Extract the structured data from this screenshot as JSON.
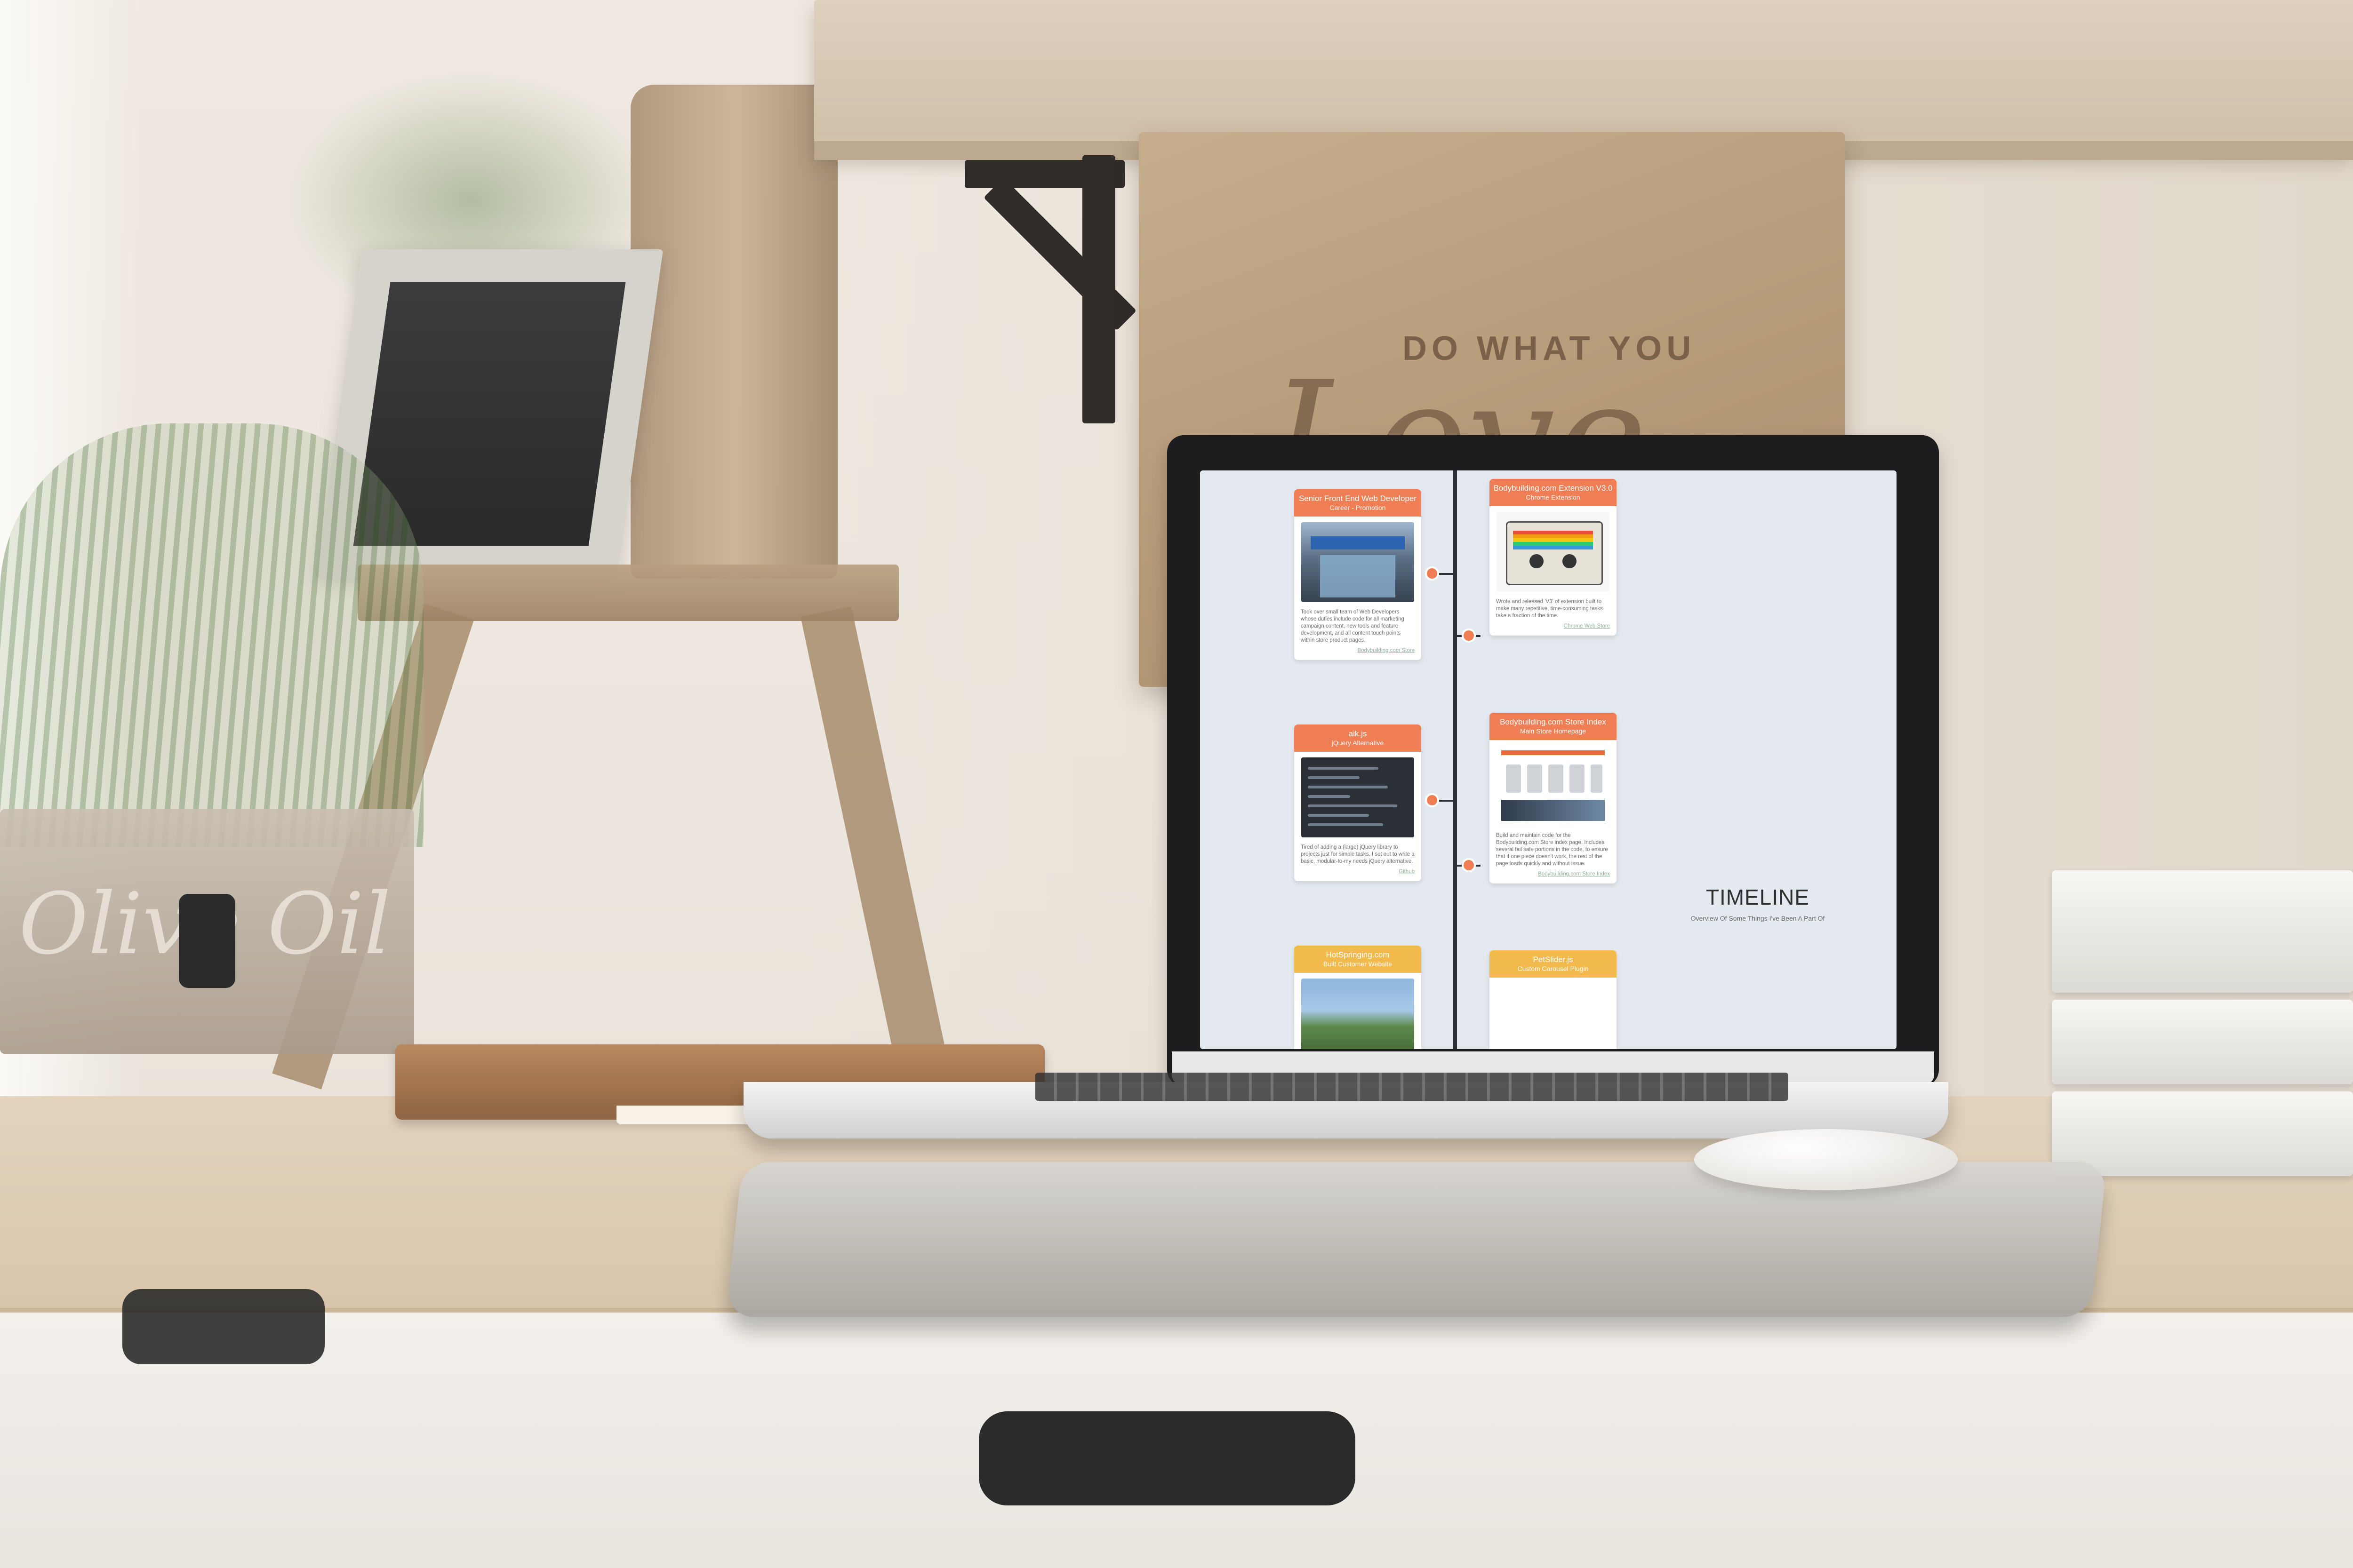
{
  "timeline": {
    "title": "TIMELINE",
    "subtitle": "Overview Of Some Things I've Been A Part Of",
    "accent_orange": "#ef7e55",
    "accent_yellow": "#f2b94d",
    "line_color": "#2c2f33"
  },
  "cards": {
    "senior": {
      "title": "Senior Front End Web Developer",
      "subtitle": "Career - Promotion",
      "text": "Took over small team of Web Developers whose duties include code for all marketing campaign content, new tools and feature development, and all content touch points within store product pages.",
      "link": "Bodybuilding.com Store"
    },
    "extension": {
      "title": "Bodybuilding.com Extension V3.0",
      "subtitle": "Chrome Extension",
      "text": "Wrote and released 'V3' of extension built to make many repetitive, time-consuming tasks take a fraction of the time.",
      "link": "Chrome Web Store"
    },
    "aikjs": {
      "title": "aik.js",
      "subtitle": "jQuery Alternative",
      "text": "Tired of adding a (large) jQuery library to projects just for simple tasks. I set out to write a basic, modular-to-my needs jQuery alternative.",
      "link": "Github"
    },
    "storeindex": {
      "title": "Bodybuilding.com Store Index",
      "subtitle": "Main Store Homepage",
      "text": "Build and maintain code for the Bodybuilding.com Store index page. Includes several fail safe portions in the code, to ensure that if one piece doesn't work, the rest of the page loads quickly and without issue.",
      "link": "Bodybuilding.com Store Index"
    },
    "hotspring": {
      "title": "HotSpringing.com",
      "subtitle": "Built Customer Website"
    },
    "petslider": {
      "title": "PetSlider.js",
      "subtitle": "Custom Carousel Plugin"
    }
  },
  "scene": {
    "sign_text_small": "DO WHAT YOU",
    "sign_text_script": "Love",
    "crate_text": "Olive Oil"
  }
}
